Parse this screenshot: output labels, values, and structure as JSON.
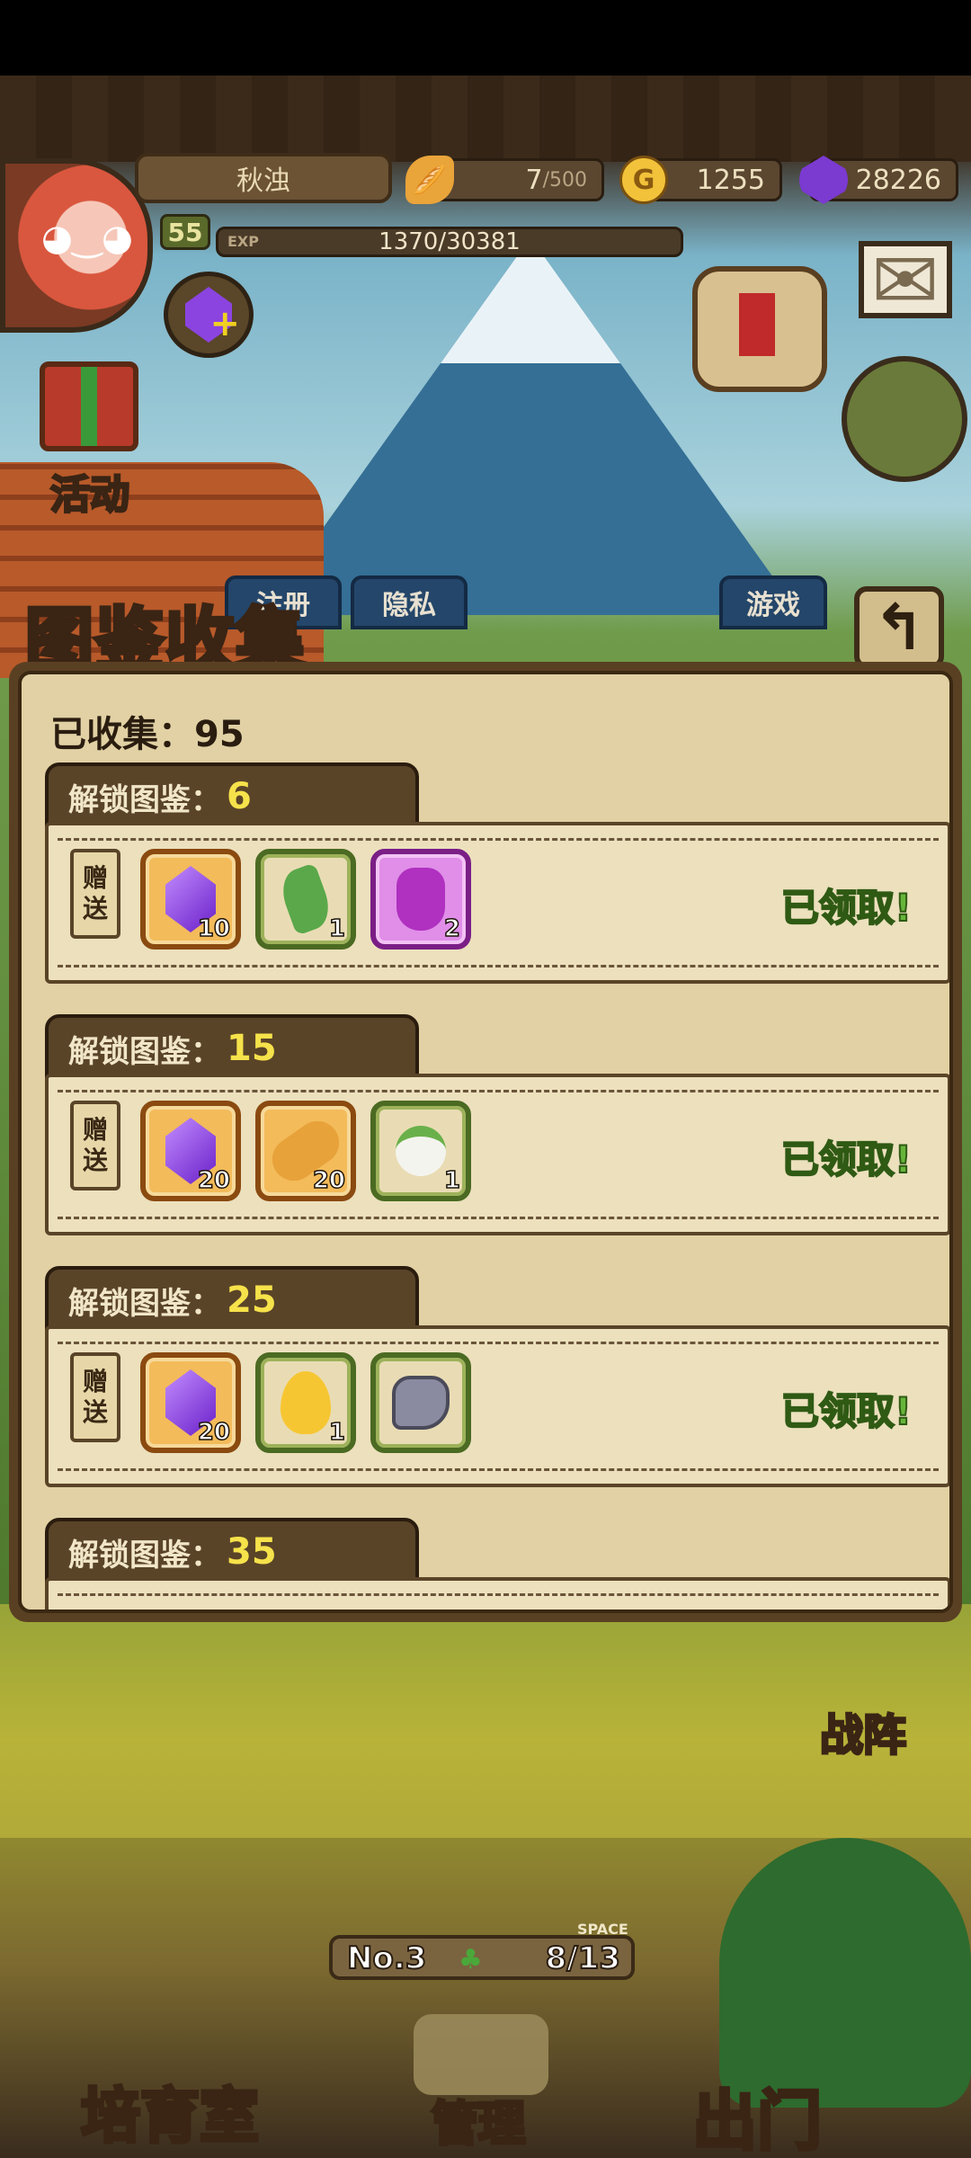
{
  "hud": {
    "player_name": "秋浊",
    "level": "55",
    "exp_tag": "EXP",
    "exp_value": "1370/30381",
    "bread_current": "7",
    "bread_max": "/500",
    "gold": "1255",
    "gems": "28226"
  },
  "side_buttons": {
    "events_label": "活动"
  },
  "tabs": [
    {
      "label": "注册"
    },
    {
      "label": "隐私"
    },
    {
      "label": "游戏"
    }
  ],
  "panel": {
    "title": "图鉴收集",
    "collected_label": "已收集：",
    "collected_count": "95",
    "unlock_label": "解锁图鉴：",
    "gift_tag": "赠送",
    "groups": [
      {
        "threshold": "6",
        "status": "已领取!",
        "items": [
          {
            "icon": "gem-icon",
            "frame": "orange",
            "qty": "10"
          },
          {
            "icon": "leaf-icon",
            "frame": "green",
            "qty": "1"
          },
          {
            "icon": "potion-icon",
            "frame": "purple",
            "qty": "2"
          }
        ]
      },
      {
        "threshold": "15",
        "status": "已领取!",
        "items": [
          {
            "icon": "gem-icon",
            "frame": "orange",
            "qty": "20"
          },
          {
            "icon": "bread-icon",
            "frame": "orange",
            "qty": "20"
          },
          {
            "icon": "turnip-icon",
            "frame": "green",
            "qty": "1"
          }
        ]
      },
      {
        "threshold": "25",
        "status": "已领取!",
        "items": [
          {
            "icon": "gem-icon",
            "frame": "orange",
            "qty": "20"
          },
          {
            "icon": "egg-icon",
            "frame": "green",
            "qty": "1"
          },
          {
            "icon": "glove-icon",
            "frame": "green",
            "qty": ""
          }
        ]
      },
      {
        "threshold": "35",
        "status": "",
        "items": []
      }
    ]
  },
  "bottom": {
    "formation_label": "战阵",
    "base_number": "No.3",
    "space_tag": "SPACE",
    "space_value": "8/13",
    "nursery_label": "培育室",
    "manage_label": "管理",
    "go_out_label": "出门"
  },
  "colors": {
    "accent_yellow": "#f6e24a",
    "claimed_green": "#67b53a",
    "panel_bg": "#e1d1a4"
  }
}
